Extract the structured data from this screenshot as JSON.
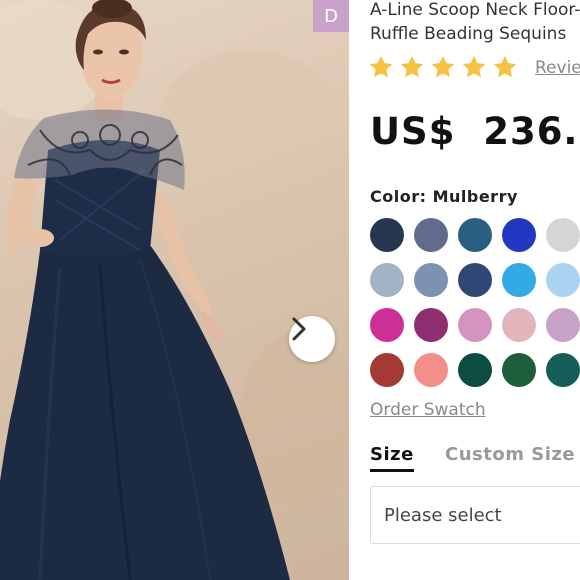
{
  "product": {
    "title_line1": "A-Line Scoop Neck Floor-",
    "title_line2": "Ruffle Beading Sequins",
    "rating": 5,
    "reviews_link": "Revie",
    "price": "US$  236."
  },
  "gallery": {
    "badge_label": "D",
    "next_button_icon": "chevron-right-icon"
  },
  "color_selector": {
    "label": "Color: Mulberry",
    "swatches": [
      "#27374f",
      "#636b8c",
      "#296081",
      "#2238c0",
      "#d5d5d5",
      "#a3b3c7",
      "#7d92b3",
      "#2d4874",
      "#33a9e6",
      "#a9d3f0",
      "#cc3096",
      "#8e2f71",
      "#d494c0",
      "#e2b5bb",
      "#c8a2c8",
      "#a33a35",
      "#f48e8b",
      "#0c4c41",
      "#1f5e3a",
      "#155e57"
    ]
  },
  "order_swatch_link": "Order Swatch",
  "size_tabs": [
    {
      "label": "Size",
      "active": true
    },
    {
      "label": "Custom Size",
      "active": false
    }
  ],
  "size_select": {
    "placeholder": "Please select"
  },
  "colors": {
    "star": "#f6c244",
    "dress": "#1c2a42",
    "badge": "#c8a2c8"
  }
}
